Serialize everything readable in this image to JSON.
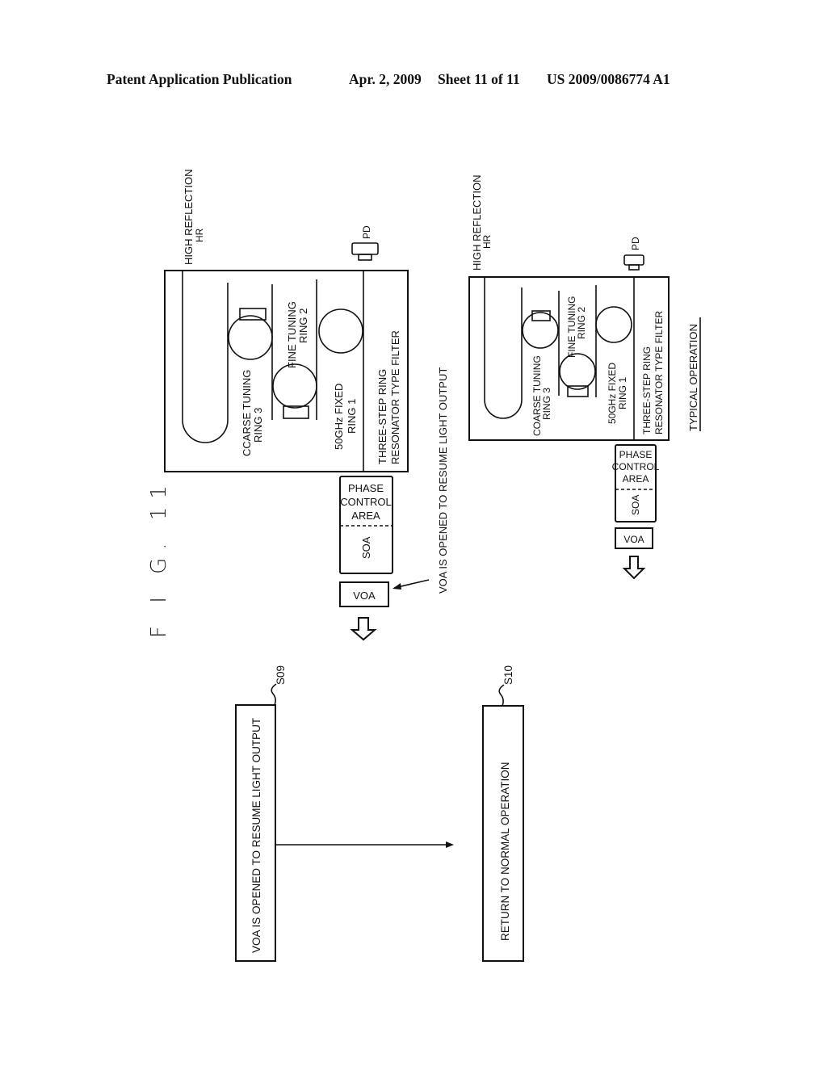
{
  "header": {
    "publication": "Patent Application Publication",
    "date": "Apr. 2, 2009",
    "sheet": "Sheet 11 of 11",
    "number": "US 2009/0086774 A1"
  },
  "figure": {
    "label": "F I G. 11",
    "left_diagram": {
      "high_reflection": "HIGH REFLECTION",
      "hr": "HR",
      "pd": "PD",
      "coarse_line1": "CCARSE TUNING",
      "coarse_line2": "RING 3",
      "fine_line1": "FINE TUNING",
      "fine_line2": "RING 2",
      "fixed_line1": "50GHz FIXED",
      "fixed_line2": "RING 1",
      "filter_line1": "THREE-STEP RING",
      "filter_line2": "RESONATOR TYPE FILTER",
      "phase_line1": "PHASE",
      "phase_line2": "CONTROL",
      "phase_line3": "AREA",
      "soa": "SOA",
      "voa": "VOA",
      "annotation": "VOA IS OPENED TO RESUME LIGHT OUTPUT"
    },
    "right_diagram": {
      "high_reflection": "HIGH REFLECTION",
      "hr": "HR",
      "pd": "PD",
      "coarse_line1": "COARSE TUNING",
      "coarse_line2": "RING 3",
      "fine_line1": "FINE TUNING",
      "fine_line2": "RING 2",
      "fixed_line1": "50GHz FIXED",
      "fixed_line2": "RING 1",
      "filter_line1": "THREE-STEP RING",
      "filter_line2": "RESONATOR TYPE FILTER",
      "phase_line1": "PHASE",
      "phase_line2": "CONTROL",
      "phase_line3": "AREA",
      "soa": "SOA",
      "voa": "VOA",
      "caption": "TYPICAL OPERATION"
    },
    "steps": [
      {
        "id": "S09",
        "text": "VOA IS OPENED TO RESUME LIGHT OUTPUT"
      },
      {
        "id": "S10",
        "text": "RETURN TO NORMAL OPERATION"
      }
    ]
  }
}
